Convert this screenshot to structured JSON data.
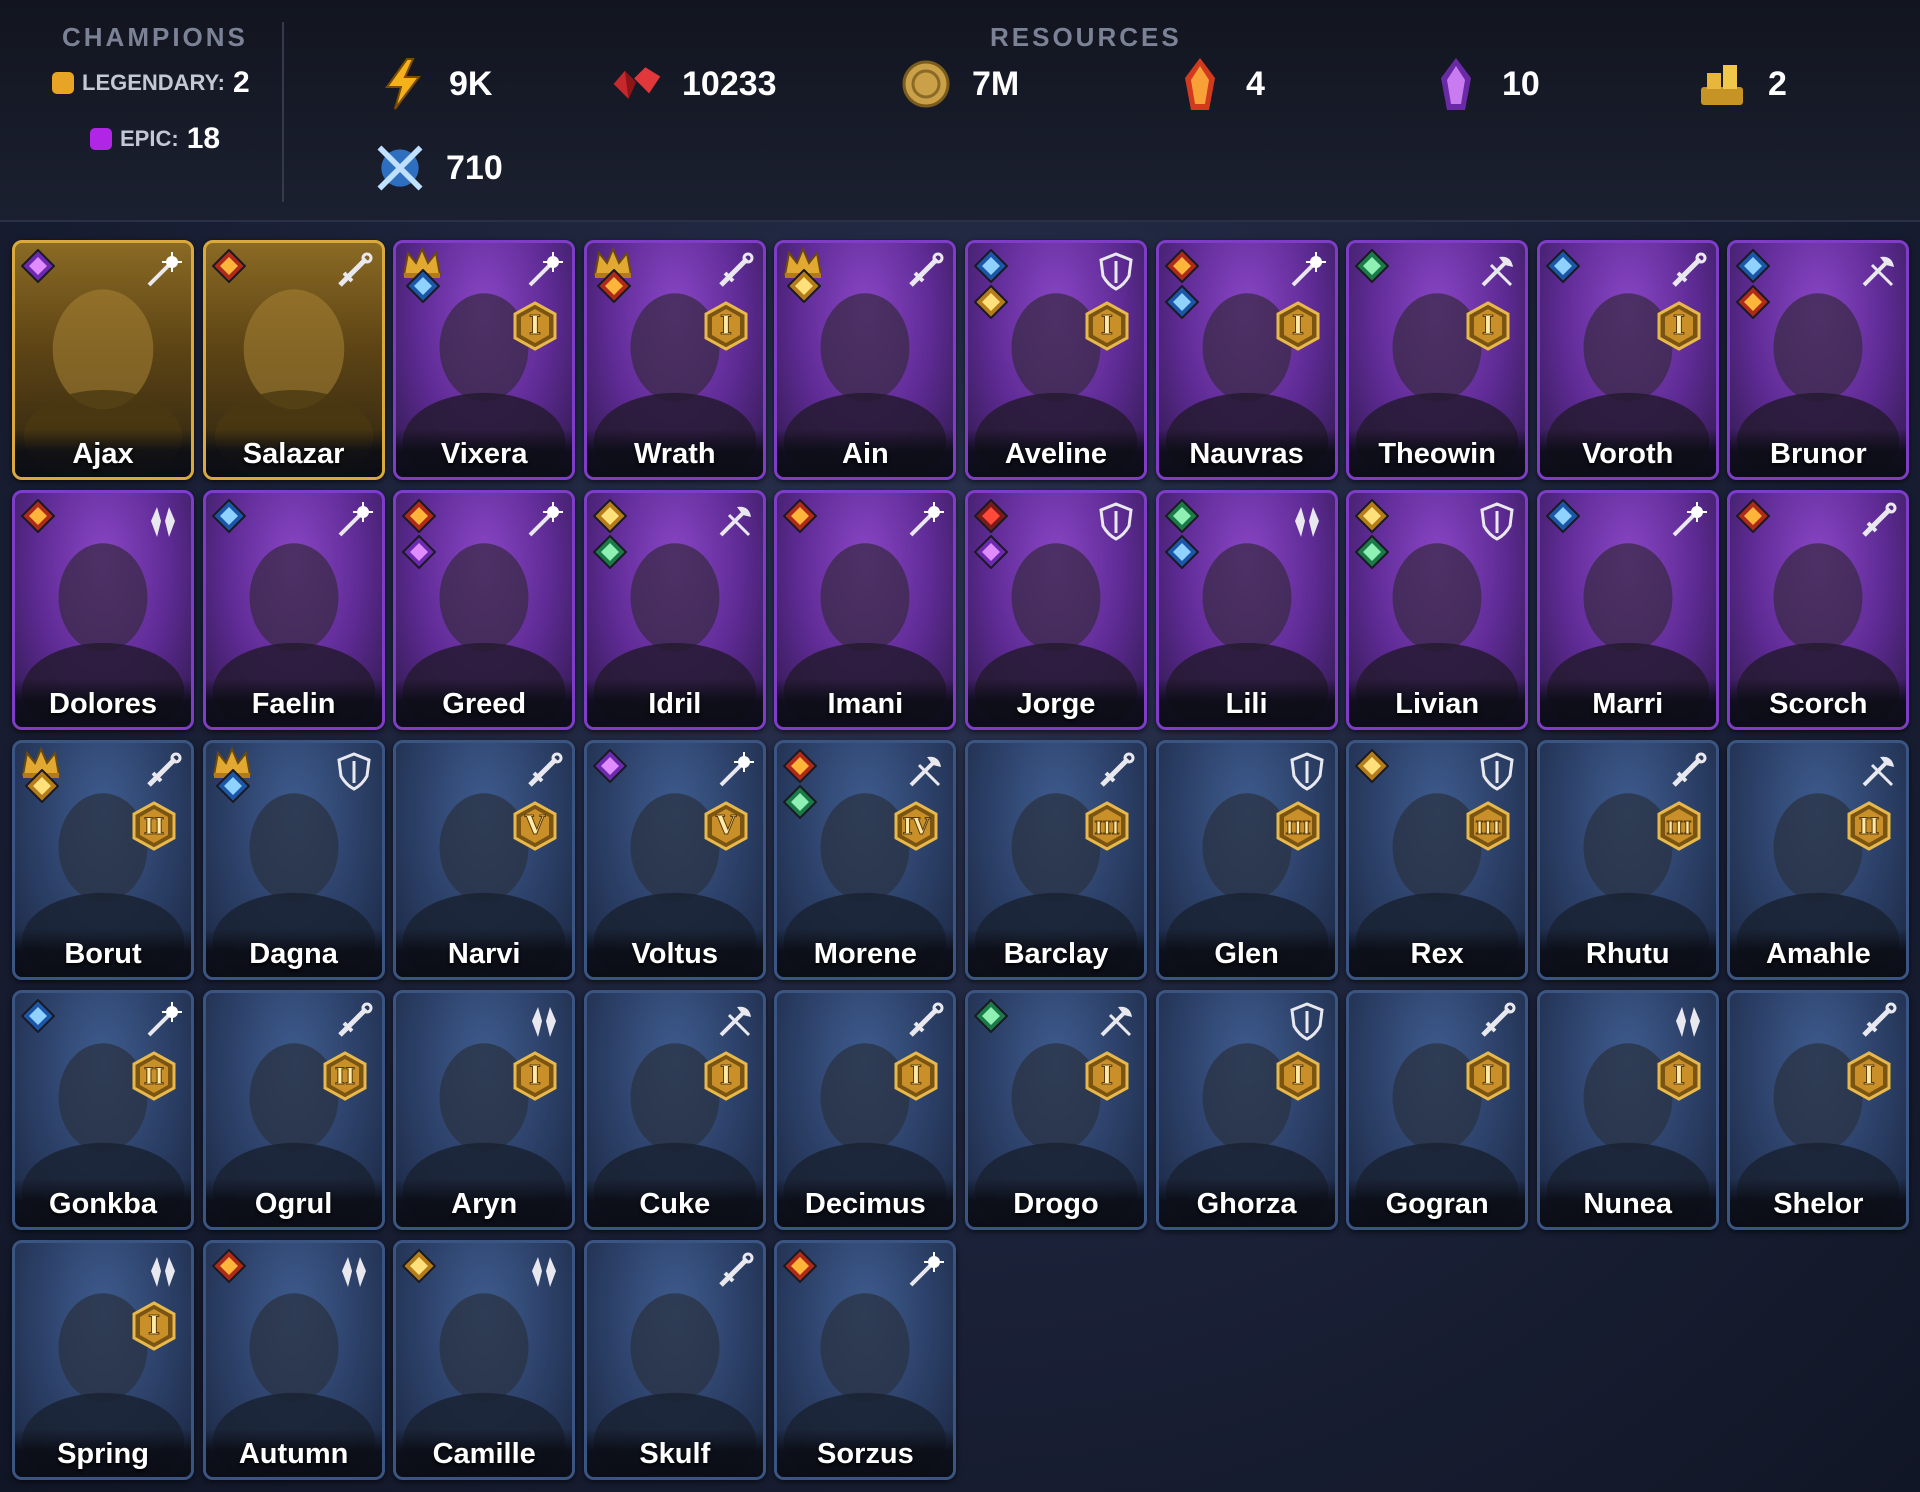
{
  "header": {
    "champions_title": "CHAMPIONS",
    "legendary_label": "LEGENDARY:",
    "legendary_count": "2",
    "epic_label": "EPIC:",
    "epic_count": "18",
    "resources_title": "RESOURCES",
    "resources": [
      {
        "icon": "energy-icon",
        "value": "9K"
      },
      {
        "icon": "ruby-icon",
        "value": "10233"
      },
      {
        "icon": "silver-coin-icon",
        "value": "7M"
      },
      {
        "icon": "fire-shard-icon",
        "value": "4"
      },
      {
        "icon": "void-shard-icon",
        "value": "10"
      },
      {
        "icon": "gold-pile-icon",
        "value": "2"
      },
      {
        "icon": "arena-token-icon",
        "value": "710"
      }
    ]
  },
  "colors": {
    "legendary": "#e8a525",
    "epic": "#b126e6",
    "rare": "#3b5582"
  },
  "champions": [
    {
      "name": "Ajax",
      "rarity": "legendary",
      "role": "magic",
      "crown": false,
      "affinities": [
        "void"
      ],
      "rank": ""
    },
    {
      "name": "Salazar",
      "rarity": "legendary",
      "role": "sword",
      "crown": false,
      "affinities": [
        "fire"
      ],
      "rank": ""
    },
    {
      "name": "Vixera",
      "rarity": "epic",
      "role": "magic",
      "crown": true,
      "affinities": [
        "water"
      ],
      "rank": "I"
    },
    {
      "name": "Wrath",
      "rarity": "epic",
      "role": "sword",
      "crown": true,
      "affinities": [
        "fire"
      ],
      "rank": "I"
    },
    {
      "name": "Ain",
      "rarity": "epic",
      "role": "sword",
      "crown": true,
      "affinities": [
        "light"
      ],
      "rank": ""
    },
    {
      "name": "Aveline",
      "rarity": "epic",
      "role": "shield",
      "crown": false,
      "affinities": [
        "water",
        "light"
      ],
      "rank": "I"
    },
    {
      "name": "Nauvras",
      "rarity": "epic",
      "role": "magic",
      "crown": false,
      "affinities": [
        "fire",
        "water"
      ],
      "rank": "I"
    },
    {
      "name": "Theowin",
      "rarity": "epic",
      "role": "axe",
      "crown": false,
      "affinities": [
        "nature"
      ],
      "rank": "I"
    },
    {
      "name": "Voroth",
      "rarity": "epic",
      "role": "sword",
      "crown": false,
      "affinities": [
        "water"
      ],
      "rank": "I"
    },
    {
      "name": "Brunor",
      "rarity": "epic",
      "role": "axe",
      "crown": false,
      "affinities": [
        "water",
        "fire"
      ],
      "rank": ""
    },
    {
      "name": "Dolores",
      "rarity": "epic",
      "role": "support",
      "crown": false,
      "affinities": [
        "fire"
      ],
      "rank": ""
    },
    {
      "name": "Faelin",
      "rarity": "epic",
      "role": "magic",
      "crown": false,
      "affinities": [
        "water"
      ],
      "rank": ""
    },
    {
      "name": "Greed",
      "rarity": "epic",
      "role": "magic",
      "crown": false,
      "affinities": [
        "fire",
        "void"
      ],
      "rank": ""
    },
    {
      "name": "Idril",
      "rarity": "epic",
      "role": "axe",
      "crown": false,
      "affinities": [
        "light",
        "nature"
      ],
      "rank": ""
    },
    {
      "name": "Imani",
      "rarity": "epic",
      "role": "magic",
      "crown": false,
      "affinities": [
        "fire"
      ],
      "rank": ""
    },
    {
      "name": "Jorge",
      "rarity": "epic",
      "role": "shield",
      "crown": false,
      "affinities": [
        "chaos",
        "void"
      ],
      "rank": ""
    },
    {
      "name": "Lili",
      "rarity": "epic",
      "role": "support",
      "crown": false,
      "affinities": [
        "nature",
        "water"
      ],
      "rank": ""
    },
    {
      "name": "Livian",
      "rarity": "epic",
      "role": "shield",
      "crown": false,
      "affinities": [
        "light",
        "nature"
      ],
      "rank": ""
    },
    {
      "name": "Marri",
      "rarity": "epic",
      "role": "magic",
      "crown": false,
      "affinities": [
        "water"
      ],
      "rank": ""
    },
    {
      "name": "Scorch",
      "rarity": "epic",
      "role": "sword",
      "crown": false,
      "affinities": [
        "fire"
      ],
      "rank": ""
    },
    {
      "name": "Borut",
      "rarity": "rare",
      "role": "sword",
      "crown": true,
      "affinities": [
        "light"
      ],
      "rank": "II"
    },
    {
      "name": "Dagna",
      "rarity": "rare",
      "role": "shield",
      "crown": true,
      "affinities": [
        "water"
      ],
      "rank": ""
    },
    {
      "name": "Narvi",
      "rarity": "rare",
      "role": "sword",
      "crown": false,
      "affinities": [],
      "rank": "V"
    },
    {
      "name": "Voltus",
      "rarity": "rare",
      "role": "magic",
      "crown": false,
      "affinities": [
        "void"
      ],
      "rank": "V"
    },
    {
      "name": "Morene",
      "rarity": "rare",
      "role": "axe",
      "crown": false,
      "affinities": [
        "fire",
        "nature"
      ],
      "rank": "IV"
    },
    {
      "name": "Barclay",
      "rarity": "rare",
      "role": "sword",
      "crown": false,
      "affinities": [],
      "rank": "III"
    },
    {
      "name": "Glen",
      "rarity": "rare",
      "role": "shield",
      "crown": false,
      "affinities": [],
      "rank": "III"
    },
    {
      "name": "Rex",
      "rarity": "rare",
      "role": "shield",
      "crown": false,
      "affinities": [
        "light"
      ],
      "rank": "III"
    },
    {
      "name": "Rhutu",
      "rarity": "rare",
      "role": "sword",
      "crown": false,
      "affinities": [],
      "rank": "III"
    },
    {
      "name": "Amahle",
      "rarity": "rare",
      "role": "axe",
      "crown": false,
      "affinities": [],
      "rank": "II"
    },
    {
      "name": "Gonkba",
      "rarity": "rare",
      "role": "magic",
      "crown": false,
      "affinities": [
        "water"
      ],
      "rank": "II"
    },
    {
      "name": "Ogrul",
      "rarity": "rare",
      "role": "sword",
      "crown": false,
      "affinities": [],
      "rank": "II"
    },
    {
      "name": "Aryn",
      "rarity": "rare",
      "role": "support",
      "crown": false,
      "affinities": [],
      "rank": "I"
    },
    {
      "name": "Cuke",
      "rarity": "rare",
      "role": "axe",
      "crown": false,
      "affinities": [],
      "rank": "I"
    },
    {
      "name": "Decimus",
      "rarity": "rare",
      "role": "sword",
      "crown": false,
      "affinities": [],
      "rank": "I"
    },
    {
      "name": "Drogo",
      "rarity": "rare",
      "role": "axe",
      "crown": false,
      "affinities": [
        "nature"
      ],
      "rank": "I"
    },
    {
      "name": "Ghorza",
      "rarity": "rare",
      "role": "shield",
      "crown": false,
      "affinities": [],
      "rank": "I"
    },
    {
      "name": "Gogran",
      "rarity": "rare",
      "role": "sword",
      "crown": false,
      "affinities": [],
      "rank": "I"
    },
    {
      "name": "Nunea",
      "rarity": "rare",
      "role": "support",
      "crown": false,
      "affinities": [],
      "rank": "I"
    },
    {
      "name": "Shelor",
      "rarity": "rare",
      "role": "sword",
      "crown": false,
      "affinities": [],
      "rank": "I"
    },
    {
      "name": "Spring",
      "rarity": "rare",
      "role": "support",
      "crown": false,
      "affinities": [],
      "rank": "I"
    },
    {
      "name": "Autumn",
      "rarity": "rare",
      "role": "support",
      "crown": false,
      "affinities": [
        "fire"
      ],
      "rank": ""
    },
    {
      "name": "Camille",
      "rarity": "rare",
      "role": "support",
      "crown": false,
      "affinities": [
        "light"
      ],
      "rank": ""
    },
    {
      "name": "Skulf",
      "rarity": "rare",
      "role": "sword",
      "crown": false,
      "affinities": [],
      "rank": ""
    },
    {
      "name": "Sorzus",
      "rarity": "rare",
      "role": "magic",
      "crown": false,
      "affinities": [
        "fire"
      ],
      "rank": ""
    }
  ]
}
